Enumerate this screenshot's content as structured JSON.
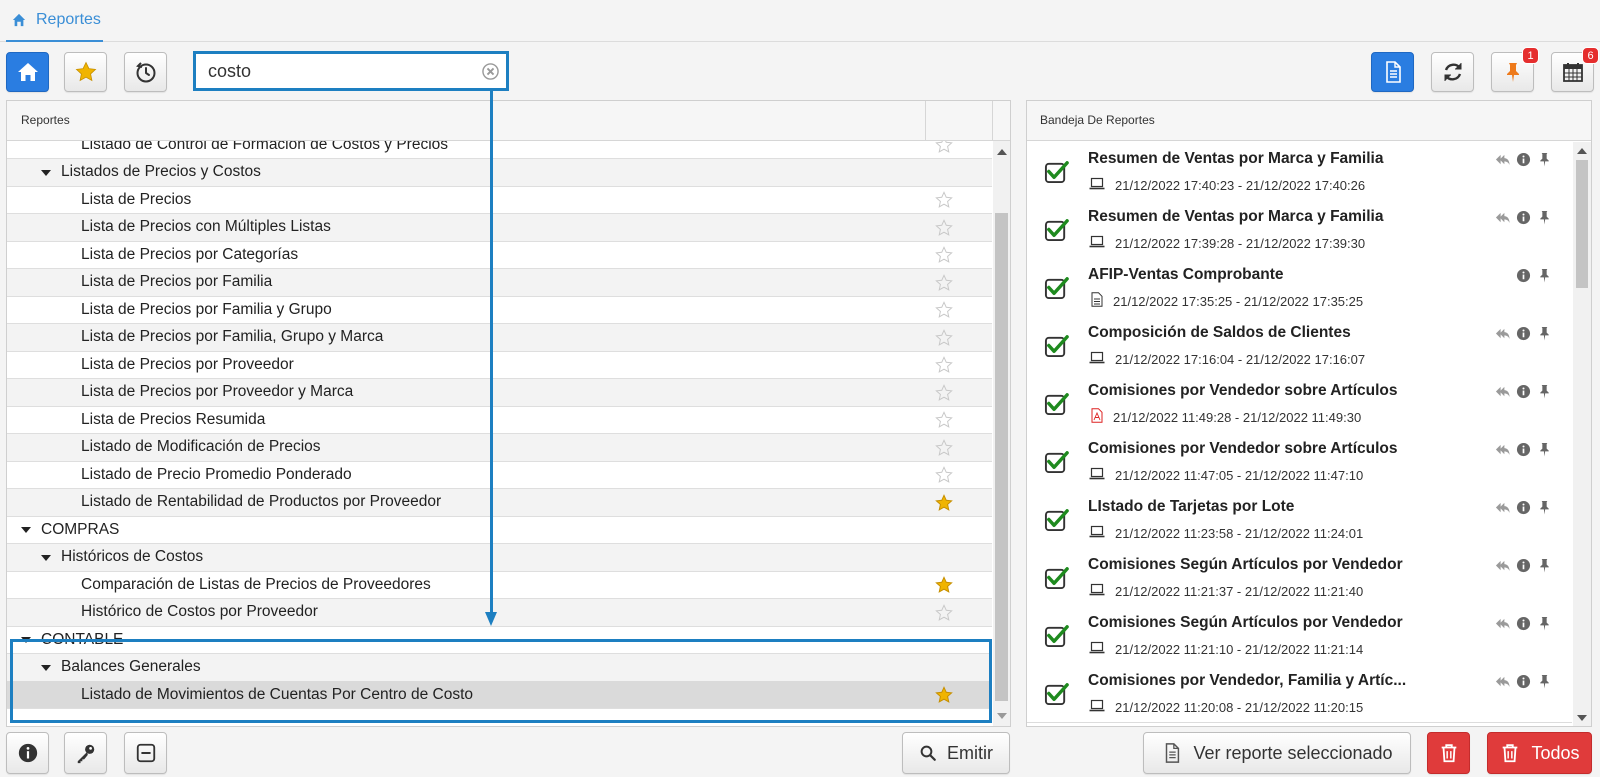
{
  "tab": {
    "label": "Reportes"
  },
  "search": {
    "value": "costo"
  },
  "left_panel": {
    "header": "Reportes",
    "rows": [
      {
        "text": "Listado de Control de Formación de Costos y Precios",
        "level": 2,
        "star": "empty"
      },
      {
        "text": "Listados de Precios y Costos",
        "level": 1,
        "star": "none"
      },
      {
        "text": "Lista de Precios",
        "level": 2,
        "star": "empty"
      },
      {
        "text": "Lista de Precios con Múltiples Listas",
        "level": 2,
        "star": "empty"
      },
      {
        "text": "Lista de Precios por Categorías",
        "level": 2,
        "star": "empty"
      },
      {
        "text": "Lista de Precios por Familia",
        "level": 2,
        "star": "empty"
      },
      {
        "text": "Lista de Precios por Familia y Grupo",
        "level": 2,
        "star": "empty"
      },
      {
        "text": "Lista de Precios por Familia, Grupo y Marca",
        "level": 2,
        "star": "empty"
      },
      {
        "text": "Lista de Precios por Proveedor",
        "level": 2,
        "star": "empty"
      },
      {
        "text": "Lista de Precios por Proveedor y Marca",
        "level": 2,
        "star": "empty"
      },
      {
        "text": "Lista de Precios Resumida",
        "level": 2,
        "star": "empty"
      },
      {
        "text": "Listado de Modificación de Precios",
        "level": 2,
        "star": "empty"
      },
      {
        "text": "Listado de Precio Promedio Ponderado",
        "level": 2,
        "star": "empty"
      },
      {
        "text": "Listado de Rentabilidad de Productos por Proveedor",
        "level": 2,
        "star": "filled"
      },
      {
        "text": "COMPRAS",
        "level": 0,
        "star": "none"
      },
      {
        "text": "Históricos de Costos",
        "level": 1,
        "star": "none"
      },
      {
        "text": "Comparación de Listas de Precios de Proveedores",
        "level": 2,
        "star": "filled"
      },
      {
        "text": "Histórico de Costos por Proveedor",
        "level": 2,
        "star": "empty"
      },
      {
        "text": "CONTABLE",
        "level": 0,
        "star": "none"
      },
      {
        "text": "Balances Generales",
        "level": 1,
        "star": "none"
      },
      {
        "text": "Listado de Movimientos de Cuentas Por Centro de Costo",
        "level": 2,
        "star": "filled",
        "selected": true
      }
    ]
  },
  "right_panel": {
    "header": "Bandeja De Reportes",
    "items": [
      {
        "title": "Resumen de Ventas por Marca y Familia",
        "dates": "21/12/2022 17:40:23 - 21/12/2022 17:40:26",
        "file": "screen",
        "reply": true
      },
      {
        "title": "Resumen de Ventas por Marca y Familia",
        "dates": "21/12/2022 17:39:28 - 21/12/2022 17:39:30",
        "file": "screen",
        "reply": true
      },
      {
        "title": "AFIP-Ventas Comprobante",
        "dates": "21/12/2022 17:35:25 - 21/12/2022 17:35:25",
        "file": "doc",
        "reply": false
      },
      {
        "title": "Composición de Saldos de Clientes",
        "dates": "21/12/2022 17:16:04 - 21/12/2022 17:16:07",
        "file": "screen",
        "reply": true
      },
      {
        "title": "Comisiones por Vendedor sobre Artículos",
        "dates": "21/12/2022 11:49:28 - 21/12/2022 11:49:30",
        "file": "pdf",
        "reply": true
      },
      {
        "title": "Comisiones por Vendedor sobre Artículos",
        "dates": "21/12/2022 11:47:05 - 21/12/2022 11:47:10",
        "file": "screen",
        "reply": true
      },
      {
        "title": "LIstado de Tarjetas por Lote",
        "dates": "21/12/2022 11:23:58 - 21/12/2022 11:24:01",
        "file": "screen",
        "reply": true
      },
      {
        "title": "Comisiones Según Artículos por Vendedor",
        "dates": "21/12/2022 11:21:37 - 21/12/2022 11:21:40",
        "file": "screen",
        "reply": true
      },
      {
        "title": "Comisiones Según Artículos por Vendedor",
        "dates": "21/12/2022 11:21:10 - 21/12/2022 11:21:14",
        "file": "screen",
        "reply": true
      },
      {
        "title": "Comisiones por Vendedor, Familia y Artíc...",
        "dates": "21/12/2022 11:20:08 - 21/12/2022 11:20:15",
        "file": "screen",
        "reply": true
      }
    ]
  },
  "toolbar_right": {
    "pin_badge": "1",
    "calendar_badge": "6"
  },
  "bottom": {
    "emitir": "Emitir",
    "ver_reporte": "Ver reporte seleccionado",
    "todos": "Todos"
  },
  "colors": {
    "accent": "#2a7de1",
    "highlight": "#1d7fc1",
    "danger": "#e03b3b",
    "check": "#1e8a1e",
    "star": "#f0b400"
  }
}
